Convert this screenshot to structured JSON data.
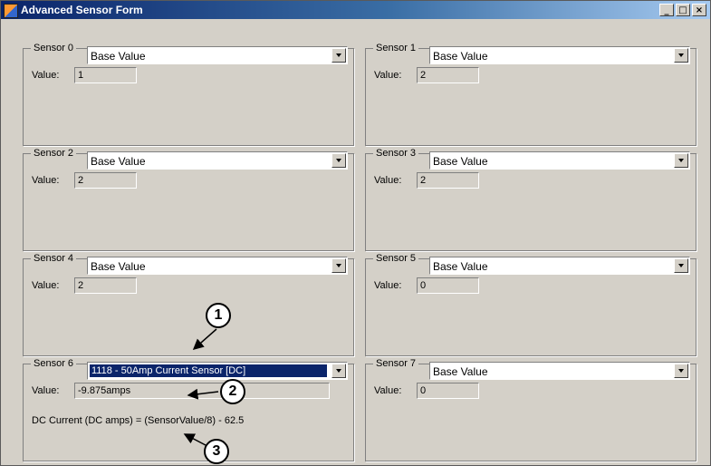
{
  "window": {
    "title": "Advanced Sensor Form",
    "minimize": "_",
    "maximize": "□",
    "close": "×"
  },
  "value_label": "Value:",
  "sensors": [
    {
      "label": "Sensor 0",
      "selection": "Base Value",
      "value": "1"
    },
    {
      "label": "Sensor 1",
      "selection": "Base Value",
      "value": "2"
    },
    {
      "label": "Sensor 2",
      "selection": "Base Value",
      "value": "2"
    },
    {
      "label": "Sensor 3",
      "selection": "Base Value",
      "value": "2"
    },
    {
      "label": "Sensor 4",
      "selection": "Base Value",
      "value": "2"
    },
    {
      "label": "Sensor 5",
      "selection": "Base Value",
      "value": "0"
    },
    {
      "label": "Sensor 6",
      "selection": "1118 - 50Amp Current Sensor [DC]",
      "value": "-9.875amps",
      "formula": "DC Current (DC amps) = (SensorValue/8) - 62.5"
    },
    {
      "label": "Sensor 7",
      "selection": "Base Value",
      "value": "0"
    }
  ],
  "callouts": [
    "1",
    "2",
    "3"
  ]
}
